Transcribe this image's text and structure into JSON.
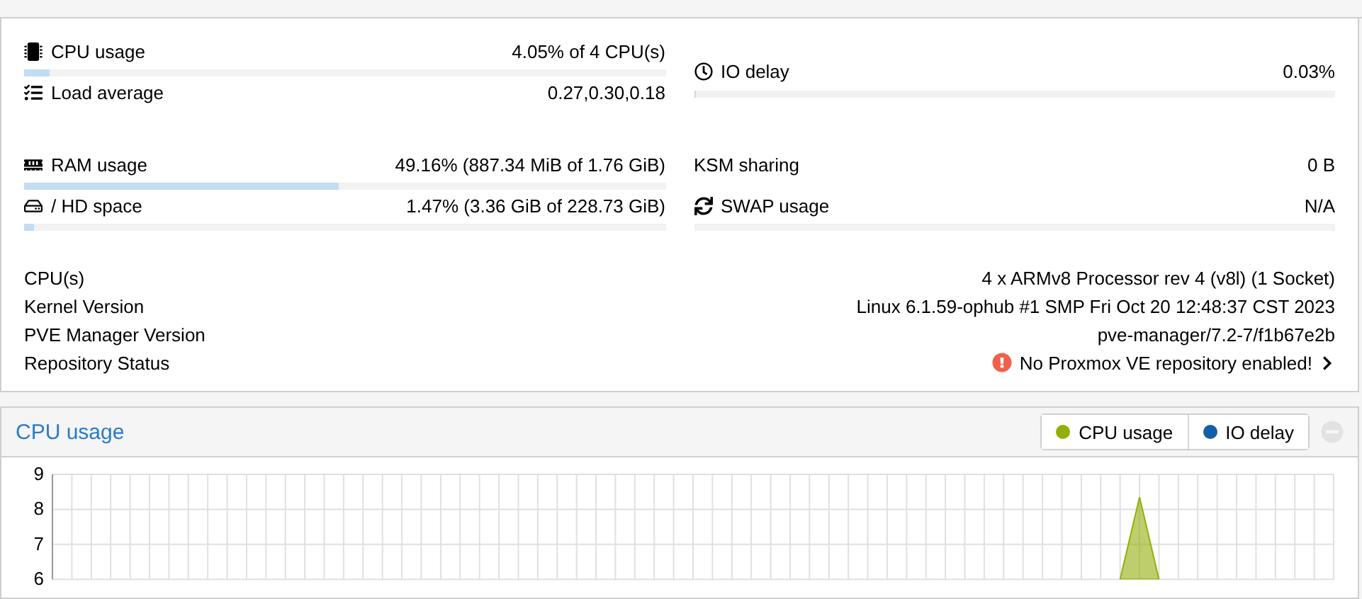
{
  "status": {
    "groups": [
      {
        "left": [
          {
            "label": "CPU usage",
            "value": "4.05% of 4 CPU(s)",
            "kind": "bar",
            "level": 0.0405
          },
          {
            "label": "Load average",
            "value": "0.27,0.30,0.18",
            "kind": "plain"
          }
        ],
        "right": [
          {
            "label": "IO delay",
            "value": "0.03%",
            "kind": "bar",
            "level": 0.003
          }
        ]
      },
      {
        "left": [
          {
            "label": "RAM usage",
            "value": "49.16% (887.34 MiB of 1.76 GiB)",
            "kind": "bar",
            "level": 0.4916
          },
          {
            "label": "/ HD space",
            "value": "1.47% (3.36 GiB of 228.73 GiB)",
            "kind": "bar",
            "level": 0.0147
          }
        ],
        "right": [
          {
            "label": "KSM sharing",
            "value": "0 B",
            "kind": "plain"
          },
          {
            "label": "SWAP usage",
            "value": "N/A",
            "kind": "bar"
          }
        ]
      }
    ]
  },
  "info": [
    {
      "label": "CPU(s)",
      "value": "4 x ARMv8 Processor rev 4 (v8l) (1 Socket)",
      "kind": "text"
    },
    {
      "label": "Kernel Version",
      "value": "Linux 6.1.59-ophub #1 SMP Fri Oct 20 12:48:37 CST 2023",
      "kind": "text"
    },
    {
      "label": "PVE Manager Version",
      "value": "pve-manager/7.2-7/f1b67e2b",
      "kind": "text"
    },
    {
      "label": "Repository Status",
      "value": "No Proxmox VE repository enabled!",
      "kind": "warning"
    }
  ],
  "cpu_panel": {
    "title": "CPU usage",
    "chart_data": {
      "type": "area",
      "ylim": [
        6,
        9
      ],
      "yticks": [
        6,
        7,
        8,
        9
      ],
      "grid": true,
      "series": [
        {
          "name": "CPU usage",
          "color": "#94ae0a",
          "values": [
            null,
            null,
            null,
            null,
            null,
            null,
            null,
            null,
            null,
            null,
            null,
            null,
            null,
            null,
            null,
            null,
            null,
            null,
            null,
            null,
            null,
            null,
            null,
            null,
            null,
            null,
            null,
            null,
            null,
            null,
            null,
            null,
            null,
            null,
            null,
            null,
            null,
            null,
            null,
            null,
            null,
            null,
            null,
            null,
            null,
            null,
            null,
            null,
            null,
            null,
            null,
            null,
            null,
            null,
            null,
            6,
            8.35,
            6,
            null,
            null,
            null,
            null,
            null,
            null,
            null,
            null,
            null
          ]
        },
        {
          "name": "IO delay",
          "color": "#115fa6",
          "values": [
            null,
            null,
            null,
            null,
            null,
            null,
            null,
            null,
            null,
            null,
            null,
            null,
            null,
            null,
            null,
            null,
            null,
            null,
            null,
            null,
            null,
            null,
            null,
            null,
            null,
            null,
            null,
            null,
            null,
            null,
            null,
            null,
            null,
            null,
            null,
            null,
            null,
            null,
            null,
            null,
            null,
            null,
            null,
            null,
            null,
            null,
            null,
            null,
            null,
            null,
            null,
            null,
            null,
            null,
            null,
            null,
            null,
            null,
            null,
            null,
            null,
            null,
            null,
            null,
            null,
            null,
            null
          ]
        }
      ]
    }
  }
}
